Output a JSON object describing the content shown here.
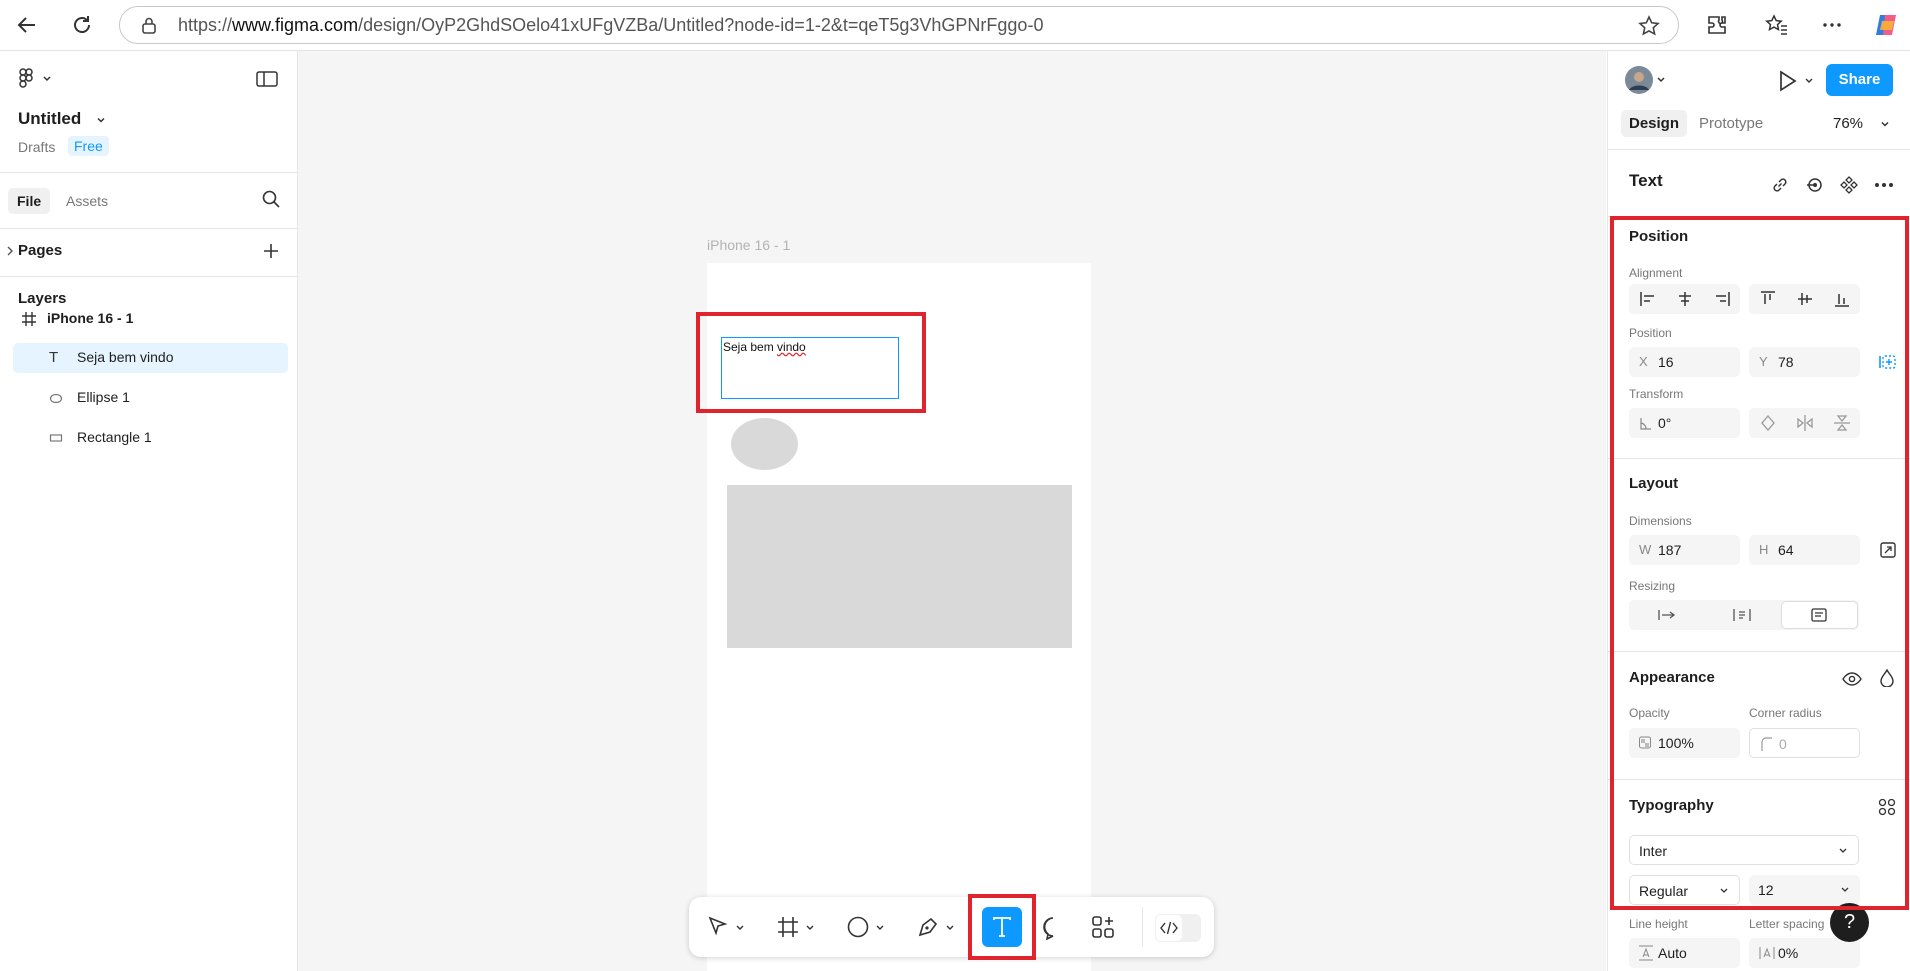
{
  "browser": {
    "url_prefix": "https://",
    "url_domain": "www.figma.com",
    "url_path": "/design/OyP2GhdSOelo41xUFgVZBa/Untitled?node-id=1-2&t=qeT5g3VhGPNrFggo-0"
  },
  "file": {
    "title": "Untitled",
    "location": "Drafts",
    "plan_badge": "Free"
  },
  "left_tabs": [
    "File",
    "Assets"
  ],
  "pages_label": "Pages",
  "layers_label": "Layers",
  "layers": [
    {
      "name": "iPhone 16 - 1",
      "icon": "frame-icon"
    },
    {
      "name": "Seja bem vindo",
      "icon": "text-icon",
      "selected": true
    },
    {
      "name": "Ellipse 1",
      "icon": "ellipse-icon"
    },
    {
      "name": "Rectangle 1",
      "icon": "rectangle-icon"
    }
  ],
  "canvas": {
    "frame_label": "iPhone 16 - 1",
    "text_content_a": "Seja bem ",
    "text_content_b": "vindo"
  },
  "right": {
    "share_label": "Share",
    "tabs": [
      "Design",
      "Prototype"
    ],
    "zoom": "76%",
    "selection_type": "Text",
    "position": {
      "heading": "Position",
      "alignment_label": "Alignment",
      "position_label": "Position",
      "x_prefix": "X",
      "x": "16",
      "y_prefix": "Y",
      "y": "78",
      "transform_label": "Transform",
      "rotation": "0°"
    },
    "layout": {
      "heading": "Layout",
      "dimensions_label": "Dimensions",
      "w_prefix": "W",
      "w": "187",
      "h_prefix": "H",
      "h": "64",
      "resizing_label": "Resizing"
    },
    "appearance": {
      "heading": "Appearance",
      "opacity_label": "Opacity",
      "opacity": "100%",
      "radius_label": "Corner radius",
      "radius": "0"
    },
    "typography": {
      "heading": "Typography",
      "font_family": "Inter",
      "font_weight": "Regular",
      "font_size": "12",
      "line_height_label": "Line height",
      "line_height": "Auto",
      "letter_spacing_label": "Letter spacing",
      "letter_spacing": "0%"
    }
  },
  "help_label": "?",
  "colors": {
    "accent": "#0d99ff",
    "highlight_red": "#e0242e",
    "selected_layer_bg": "#e5f4ff"
  }
}
